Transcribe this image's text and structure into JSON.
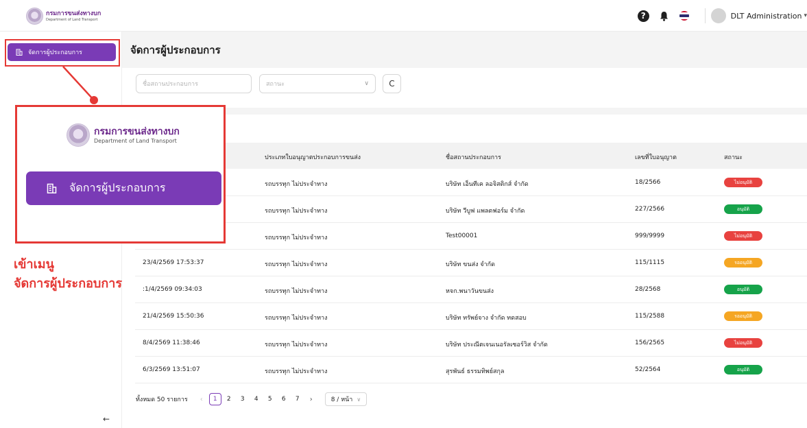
{
  "brand": {
    "name_th": "กรมการขนส่งทางบก",
    "name_en": "Department of Land Transport"
  },
  "header": {
    "user_name": "DLT Administration"
  },
  "sidebar": {
    "items": [
      {
        "label": "จัดการผู้ประกอบการ"
      }
    ]
  },
  "page": {
    "title": "จัดการผู้ประกอบการ"
  },
  "filters": {
    "name_placeholder": "ชื่อสถานประกอบการ",
    "status_placeholder": "สถานะ"
  },
  "table": {
    "columns": [
      "",
      "ประเภทใบอนุญาตประกอบการขนส่ง",
      "ชื่อสถานประกอบการ",
      "เลขที่ใบอนุญาต",
      "สถานะ"
    ],
    "rows": [
      {
        "date": "",
        "type": "รถบรรทุก ไม่ประจำทาง",
        "name": "บริษัท เอ็นทีเค ลอจิสติกส์ จำกัด",
        "license": "18/2566",
        "status": "ไม่อนุมัติ",
        "status_color": "#e8423f"
      },
      {
        "date": "",
        "type": "รถบรรทุก ไม่ประจำทาง",
        "name": "บริษัท วีบูฟ แพลตฟอร์ม จำกัด",
        "license": "227/2566",
        "status": "อนุมัติ",
        "status_color": "#16a34a"
      },
      {
        "date": "",
        "type": "รถบรรทุก ไม่ประจำทาง",
        "name": "Test00001",
        "license": "999/9999",
        "status": "ไม่อนุมัติ",
        "status_color": "#e8423f"
      },
      {
        "date": "23/4/2569 17:53:37",
        "type": "รถบรรทุก ไม่ประจำทาง",
        "name": "บริษัท ขนส่ง จำกัด",
        "license": "115/1115",
        "status": "รออนุมัติ",
        "status_color": "#f5a623"
      },
      {
        "date": ":1/4/2569 09:34:03",
        "type": "รถบรรทุก ไม่ประจำทาง",
        "name": "หจก.พนาวันขนส่ง",
        "license": "28/2568",
        "status": "อนุมัติ",
        "status_color": "#16a34a"
      },
      {
        "date": "21/4/2569 15:50:36",
        "type": "รถบรรทุก ไม่ประจำทาง",
        "name": "บริษัท ทรัพย์จาง จำกัด ทดสอบ",
        "license": "115/2588",
        "status": "รออนุมัติ",
        "status_color": "#f5a623"
      },
      {
        "date": "8/4/2569 11:38:46",
        "type": "รถบรรทุก ไม่ประจำทาง",
        "name": "บริษัท ประณีตเจนเนอรัลเซอร์วิส จำกัด",
        "license": "156/2565",
        "status": "ไม่อนุมัติ",
        "status_color": "#e8423f"
      },
      {
        "date": "6/3/2569 13:51:07",
        "type": "รถบรรทุก ไม่ประจำทาง",
        "name": "สุรพันธ์ ธรรมทิพย์สกุล",
        "license": "52/2564",
        "status": "อนุมัติ",
        "status_color": "#16a34a"
      }
    ]
  },
  "pagination": {
    "total_text": "ทั้งหมด 50 รายการ",
    "pages": [
      "1",
      "2",
      "3",
      "4",
      "5",
      "6",
      "7"
    ],
    "current": "1",
    "page_size": "8 / หน้า"
  },
  "callout": {
    "menu_label": "จัดการผู้ประกอบการ",
    "caption_line1": "เข้าเมนู",
    "caption_line2": "จัดการผู้ประกอบการ"
  },
  "colors": {
    "accent": "#7a3bb6",
    "annotation_red": "#e53935"
  }
}
